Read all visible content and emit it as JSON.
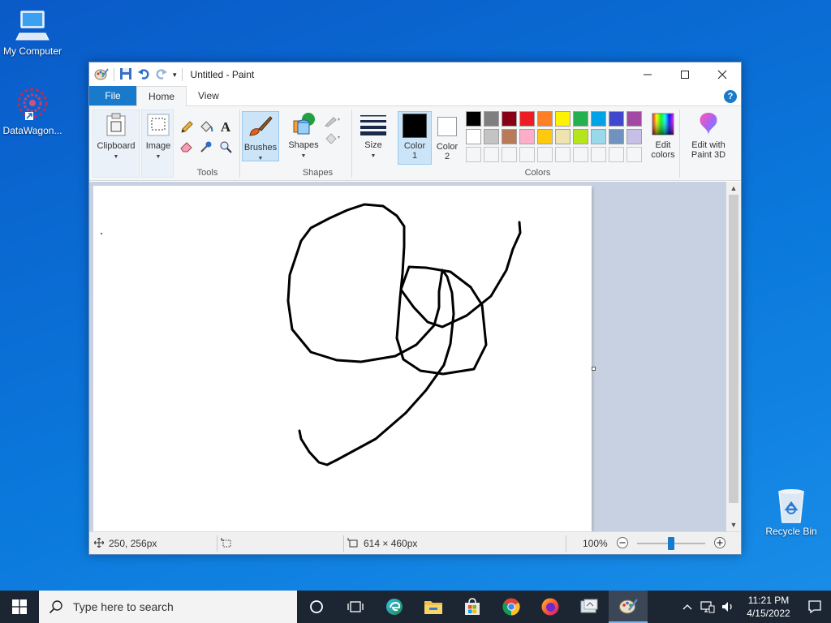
{
  "desktop": {
    "icons": [
      {
        "label": "My Computer"
      },
      {
        "label": "DataWagon..."
      },
      {
        "label": "Recycle Bin"
      }
    ]
  },
  "window": {
    "title": "Untitled - Paint"
  },
  "tabs": [
    {
      "label": "File"
    },
    {
      "label": "Home"
    },
    {
      "label": "View"
    }
  ],
  "ribbon": {
    "clipboard": "Clipboard",
    "image": "Image",
    "tools_group": "Tools",
    "brushes": "Brushes",
    "shapes_button": "Shapes",
    "shapes_group": "Shapes",
    "size": "Size",
    "color1": [
      "Color",
      "1"
    ],
    "color2": [
      "Color",
      "2"
    ],
    "colors_group": "Colors",
    "edit_colors": [
      "Edit",
      "colors"
    ],
    "edit_paint3d": [
      "Edit with",
      "Paint 3D"
    ],
    "active_color1": "#000000",
    "active_color2": "#ffffff",
    "palette_row1": [
      "#000000",
      "#7f7f7f",
      "#880015",
      "#ed1c24",
      "#ff7f27",
      "#fff200",
      "#22b14c",
      "#00a2e8",
      "#3f48cc",
      "#a349a4"
    ],
    "palette_row2": [
      "#ffffff",
      "#c3c3c3",
      "#b97a57",
      "#ffaec9",
      "#ffc90e",
      "#efe4b0",
      "#b5e61d",
      "#99d9ea",
      "#7092be",
      "#c8bfe7"
    ]
  },
  "status": {
    "cursor_pos": "250, 256px",
    "canvas_size": "614 × 460px",
    "zoom": "100%",
    "zoom_level": 0.5
  },
  "taskbar": {
    "search_placeholder": "Type here to search",
    "time": "11:21 PM",
    "date": "4/15/2022"
  }
}
